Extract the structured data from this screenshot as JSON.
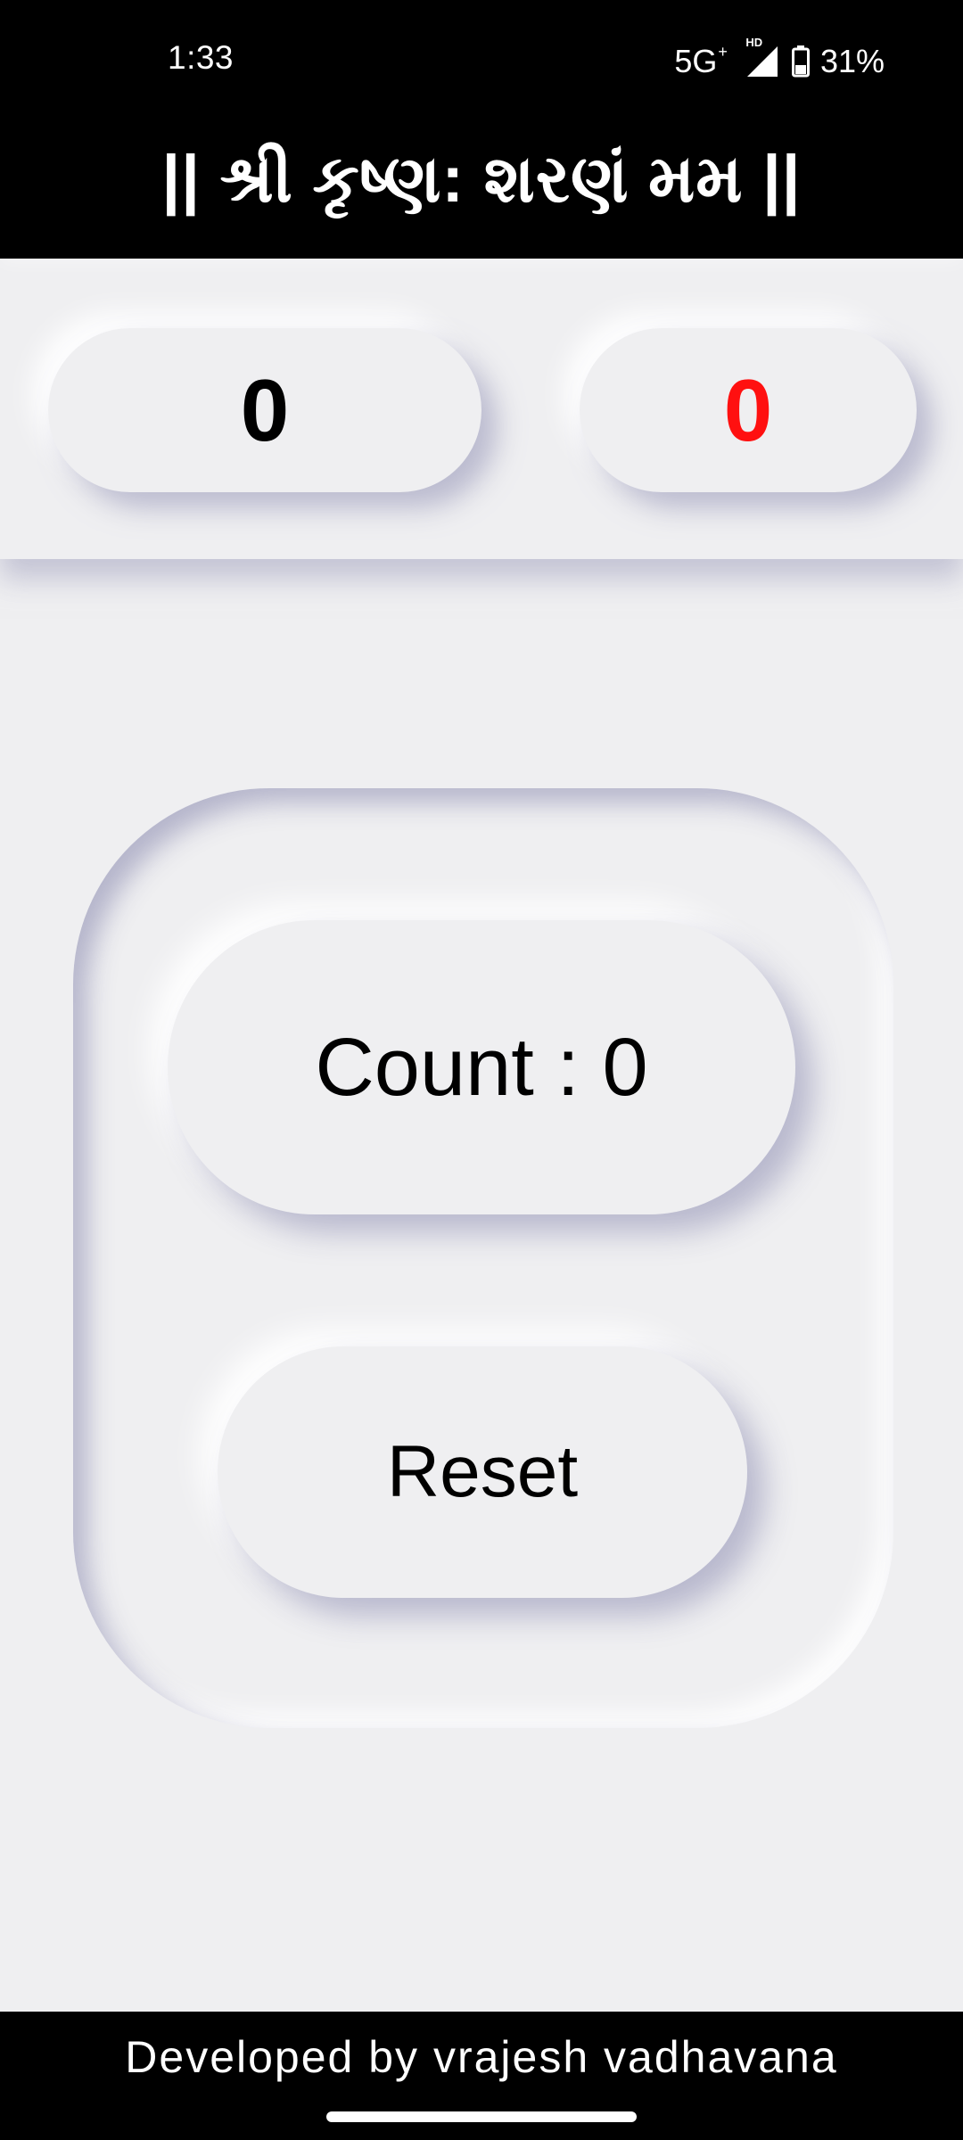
{
  "status_bar": {
    "time": "1:33",
    "network": "5G",
    "network_suffix": "+",
    "hd_tag": "HD",
    "signal_icon": "signal-icon",
    "battery_icon": "battery-icon",
    "battery": "31%"
  },
  "header": {
    "title": "|| શ્રી કૃષ્ણ: શરણં મમ ||"
  },
  "counters": {
    "left_value": "0",
    "right_value": "0",
    "right_color": "#ff1010"
  },
  "main": {
    "count_label": "Count : 0",
    "reset_label": "Reset"
  },
  "footer": {
    "credit": "Developed by vrajesh vadhavana"
  },
  "colors": {
    "background": "#efeff1",
    "bars": "#000000",
    "accent_red": "#ff1010"
  }
}
